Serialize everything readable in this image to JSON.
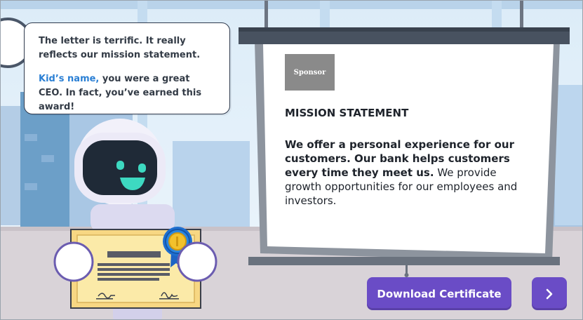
{
  "bubble": {
    "line1": "The letter is terrific. It really reflects our mission statement.",
    "kid_name": "Kid’s name,",
    "line2_rest": " you were a great CEO. In fact, you’ve earned this award!"
  },
  "board": {
    "sponsor_label": "Sponsor",
    "title": "MISSION STATEMENT",
    "body_bold": "We offer a personal experience for our customers. Our bank helps customers every time they meet us.",
    "body_rest": " We provide growth opportunities for our employees and investors."
  },
  "actions": {
    "download_label": "Download Certificate",
    "next_icon": "chevron-right-icon"
  },
  "colors": {
    "accent": "#6a4cc6",
    "kid_name": "#2a7fd4",
    "robot_face": "#3dd9c1"
  }
}
